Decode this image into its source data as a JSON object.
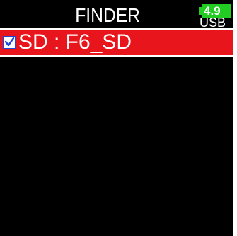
{
  "header": {
    "title": "FINDER",
    "battery_level": "4.9",
    "power_source": "USB"
  },
  "list": {
    "items": [
      {
        "label": "SD : F6_SD",
        "checked": true,
        "selected": true
      }
    ]
  },
  "colors": {
    "background": "#000000",
    "selection": "#e8151c",
    "battery": "#22cc22",
    "checkbox_accent": "#1a47d8",
    "text": "#ffffff"
  },
  "icons": {
    "battery": "battery-icon",
    "checkbox": "checkbox-checked-icon"
  }
}
